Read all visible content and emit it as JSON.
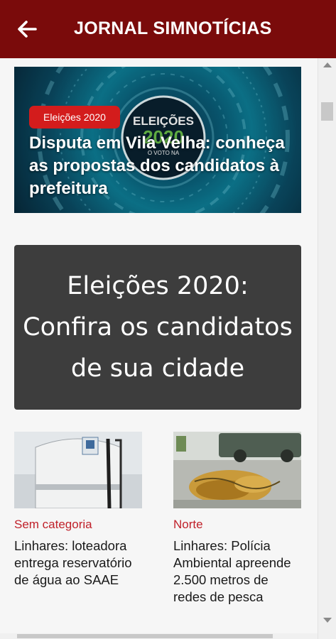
{
  "appbar": {
    "title": "JORNAL SIMNOTÍCIAS",
    "back_icon": "arrow-left-icon",
    "background": "#7a0b0b"
  },
  "hero": {
    "badge": "Eleições 2020",
    "title": "Disputa em Vila Velha: conheça as propostas dos candidatos à prefeitura",
    "logo_line1": "ELEIÇÕES",
    "logo_line2": "2020",
    "logo_line3": "O VOTO NA"
  },
  "banner": {
    "text": "Eleições 2020: Confira os candidatos de sua cidade"
  },
  "cards": [
    {
      "category": "Sem categoria",
      "title": "Linhares: loteadora entrega reservatório de água ao SAAE"
    },
    {
      "category": "Norte",
      "title": "Linhares: Polícia Ambiental apreende 2.500 metros de redes de pesca"
    }
  ],
  "colors": {
    "accent": "#7a0b0b",
    "badge": "#d31c1c",
    "category": "#c0212a"
  }
}
